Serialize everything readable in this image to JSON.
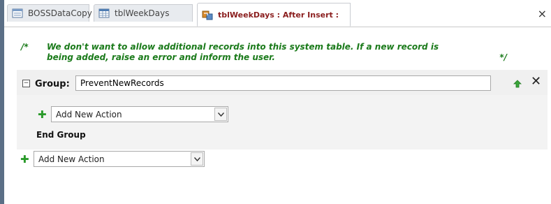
{
  "tabs": [
    {
      "label": "BOSSDataCopy",
      "icon": "form-icon"
    },
    {
      "label": "tblWeekDays",
      "icon": "table-icon"
    },
    {
      "label": "tblWeekDays : After Insert :",
      "icon": "macro-icon",
      "active": true
    }
  ],
  "tabbar": {
    "close_label": "×"
  },
  "comment": {
    "open": "/*",
    "line1": "We don't want to allow additional records into this system table. If a new record is",
    "line2": "being added, raise an error and inform the user.",
    "close": "*/"
  },
  "group": {
    "collapse_symbol": "⊟",
    "label": "Group:",
    "name_value": "PreventNewRecords",
    "delete_label": "✕",
    "inner_add_action": "Add New Action",
    "end_label": "End Group"
  },
  "outer_add_action": "Add New Action",
  "colors": {
    "comment": "#1a7a1a",
    "plus": "#2a9a2a",
    "active_tab_text": "#8a1d1d"
  }
}
